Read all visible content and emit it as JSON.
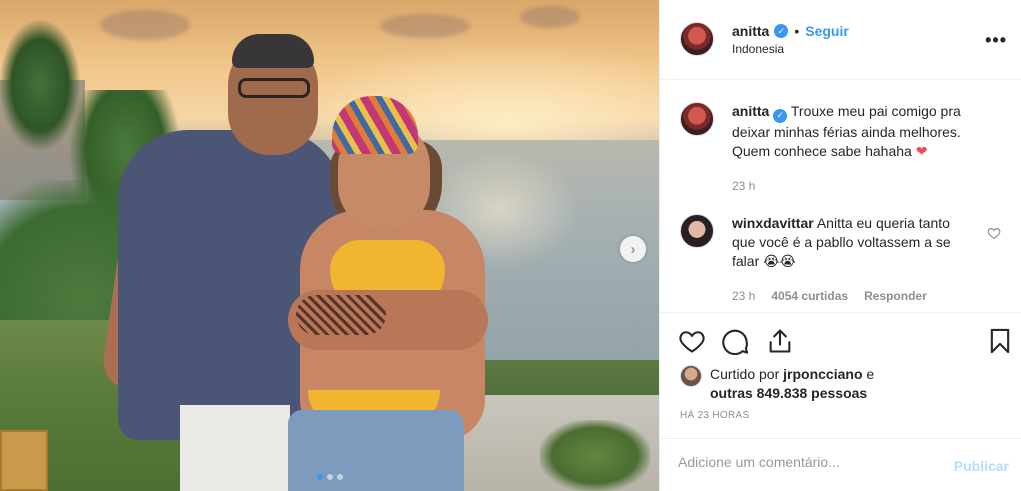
{
  "post": {
    "carousel": {
      "dots": 3,
      "active_dot": 1,
      "next_icon": "chevron-right-icon"
    }
  },
  "header": {
    "username": "anitta",
    "verified_icon": "verified-badge-icon",
    "separator": "•",
    "follow_label": "Seguir",
    "location": "Indonesia",
    "more_icon": "more-options-icon",
    "more_label": "•••"
  },
  "caption": {
    "username": "anitta",
    "text": "Trouxe meu pai comigo pra deixar minhas férias ainda melhores. Quem conhece sabe hahaha",
    "emoji": "❤",
    "time": "23 h"
  },
  "comments": [
    {
      "username": "winxdavittar",
      "text": "Anitta eu queria tanto que você é a pabllo voltassem a se falar",
      "emoji": "😭😭",
      "time": "23 h",
      "likes": "4054 curtidas",
      "reply_label": "Responder"
    }
  ],
  "actions": {
    "like_icon": "heart-icon",
    "comment_icon": "comment-icon",
    "share_icon": "share-icon",
    "save_icon": "bookmark-icon"
  },
  "likes": {
    "prefix": "Curtido por",
    "user": "jrponcciano",
    "connector": "e",
    "others": "outras 849.838 pessoas"
  },
  "timeago": "HÁ 23 HORAS",
  "comment_box": {
    "placeholder": "Adicione um comentário...",
    "publish_label": "Publicar"
  },
  "colors": {
    "accent": "#3897f0",
    "muted": "#8e8e8e",
    "text": "#262626",
    "heart": "#ed4956"
  }
}
